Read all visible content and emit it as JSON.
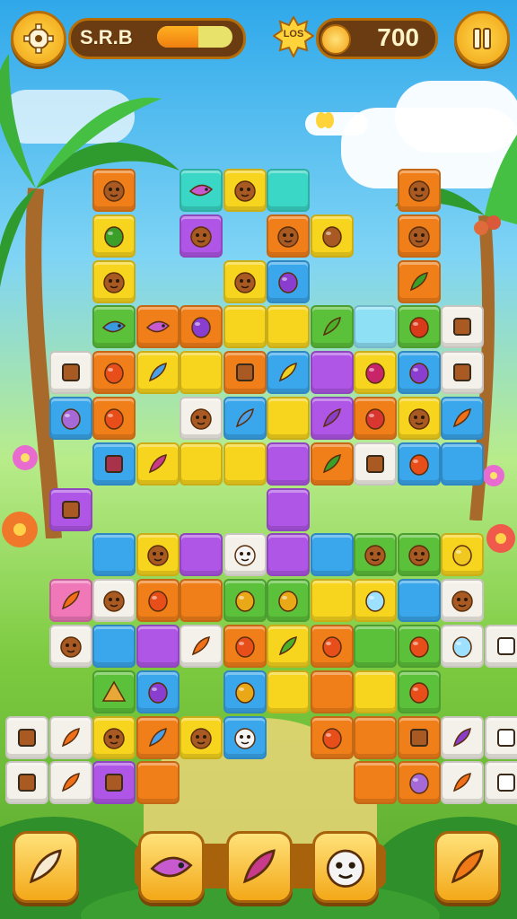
{
  "hud": {
    "level_label": "S.R.B",
    "progress": 0.55,
    "badge_text": "LOS",
    "score": "700",
    "settings_icon": "gear-icon",
    "pause_icon": "pause-icon"
  },
  "colors": {
    "orange": "#f07f1a",
    "yellow": "#f7d51e",
    "green": "#5cc13a",
    "blue": "#3aa6ec",
    "purple": "#b056e6",
    "pink": "#f077b8",
    "teal": "#3ad6c6",
    "white": "#f4f0ea",
    "red": "#e8462e",
    "lightblue": "#8ee0f4"
  },
  "tiles": [
    {
      "c": 2,
      "r": 0,
      "color": "orange",
      "icon": "fox-face-icon"
    },
    {
      "c": 4,
      "r": 0,
      "color": "teal",
      "icon": "bird-icon"
    },
    {
      "c": 5,
      "r": 0,
      "color": "yellow",
      "icon": "pig-face-icon"
    },
    {
      "c": 6,
      "r": 0,
      "color": "teal",
      "icon": ""
    },
    {
      "c": 9,
      "r": 0,
      "color": "orange",
      "icon": "monkey-face-icon"
    },
    {
      "c": 2,
      "r": 1,
      "color": "yellow",
      "icon": "bush-icon"
    },
    {
      "c": 4,
      "r": 1,
      "color": "purple",
      "icon": "crab-icon"
    },
    {
      "c": 6,
      "r": 1,
      "color": "orange",
      "icon": "squirrel-icon"
    },
    {
      "c": 7,
      "r": 1,
      "color": "yellow",
      "icon": "flower-icon"
    },
    {
      "c": 9,
      "r": 1,
      "color": "orange",
      "icon": "monkey-face-icon"
    },
    {
      "c": 2,
      "r": 2,
      "color": "yellow",
      "icon": "bear-face-icon"
    },
    {
      "c": 5,
      "r": 2,
      "color": "yellow",
      "icon": "fox-face-icon"
    },
    {
      "c": 6,
      "r": 2,
      "color": "blue",
      "icon": "plum-icon"
    },
    {
      "c": 9,
      "r": 2,
      "color": "orange",
      "icon": "leaf-icon"
    },
    {
      "c": 2,
      "r": 3,
      "color": "green",
      "icon": "fish-icon"
    },
    {
      "c": 3,
      "r": 3,
      "color": "orange",
      "icon": "bird-icon"
    },
    {
      "c": 4,
      "r": 3,
      "color": "orange",
      "icon": "plum-icon"
    },
    {
      "c": 5,
      "r": 3,
      "color": "yellow",
      "icon": ""
    },
    {
      "c": 6,
      "r": 3,
      "color": "yellow",
      "icon": ""
    },
    {
      "c": 7,
      "r": 3,
      "color": "green",
      "icon": "pea-pod-icon"
    },
    {
      "c": 8,
      "r": 3,
      "color": "lightblue",
      "icon": ""
    },
    {
      "c": 9,
      "r": 3,
      "color": "green",
      "icon": "tomato-icon"
    },
    {
      "c": 10,
      "r": 3,
      "color": "white",
      "icon": "shell-icon"
    },
    {
      "c": 1,
      "r": 4,
      "color": "white",
      "icon": "treasure-chest-icon"
    },
    {
      "c": 2,
      "r": 4,
      "color": "orange",
      "icon": "orange-icon"
    },
    {
      "c": 3,
      "r": 4,
      "color": "yellow",
      "icon": "feather-icon"
    },
    {
      "c": 4,
      "r": 4,
      "color": "yellow",
      "icon": ""
    },
    {
      "c": 5,
      "r": 4,
      "color": "orange",
      "icon": "book-icon"
    },
    {
      "c": 6,
      "r": 4,
      "color": "blue",
      "icon": "corn-icon"
    },
    {
      "c": 7,
      "r": 4,
      "color": "purple",
      "icon": ""
    },
    {
      "c": 8,
      "r": 4,
      "color": "yellow",
      "icon": "cherry-icon"
    },
    {
      "c": 9,
      "r": 4,
      "color": "blue",
      "icon": "plum-icon"
    },
    {
      "c": 10,
      "r": 4,
      "color": "white",
      "icon": "shell-icon"
    },
    {
      "c": 1,
      "r": 5,
      "color": "blue",
      "icon": "egg-icon"
    },
    {
      "c": 2,
      "r": 5,
      "color": "orange",
      "icon": "orange-icon"
    },
    {
      "c": 4,
      "r": 5,
      "color": "white",
      "icon": "deer-face-icon"
    },
    {
      "c": 5,
      "r": 5,
      "color": "blue",
      "icon": "feather-icon"
    },
    {
      "c": 6,
      "r": 5,
      "color": "yellow",
      "icon": ""
    },
    {
      "c": 7,
      "r": 5,
      "color": "purple",
      "icon": "eggplant-icon"
    },
    {
      "c": 8,
      "r": 5,
      "color": "orange",
      "icon": "strawberry-icon"
    },
    {
      "c": 9,
      "r": 5,
      "color": "yellow",
      "icon": "turtle-icon"
    },
    {
      "c": 10,
      "r": 5,
      "color": "blue",
      "icon": "carrot-icon"
    },
    {
      "c": 2,
      "r": 6,
      "color": "blue",
      "icon": "cube-icon"
    },
    {
      "c": 3,
      "r": 6,
      "color": "yellow",
      "icon": "radish-icon"
    },
    {
      "c": 4,
      "r": 6,
      "color": "yellow",
      "icon": ""
    },
    {
      "c": 5,
      "r": 6,
      "color": "yellow",
      "icon": ""
    },
    {
      "c": 6,
      "r": 6,
      "color": "purple",
      "icon": ""
    },
    {
      "c": 7,
      "r": 6,
      "color": "orange",
      "icon": "sprout-icon"
    },
    {
      "c": 8,
      "r": 6,
      "color": "white",
      "icon": "door-icon"
    },
    {
      "c": 9,
      "r": 6,
      "color": "blue",
      "icon": "orange-icon"
    },
    {
      "c": 10,
      "r": 6,
      "color": "blue",
      "icon": ""
    },
    {
      "c": 1,
      "r": 7,
      "color": "purple",
      "icon": "gate-icon"
    },
    {
      "c": 6,
      "r": 7,
      "color": "purple",
      "icon": ""
    },
    {
      "c": 2,
      "r": 8,
      "color": "blue",
      "icon": ""
    },
    {
      "c": 3,
      "r": 8,
      "color": "yellow",
      "icon": "lion-face-icon"
    },
    {
      "c": 4,
      "r": 8,
      "color": "purple",
      "icon": ""
    },
    {
      "c": 5,
      "r": 8,
      "color": "white",
      "icon": "jellyfish-icon"
    },
    {
      "c": 6,
      "r": 8,
      "color": "purple",
      "icon": ""
    },
    {
      "c": 7,
      "r": 8,
      "color": "blue",
      "icon": ""
    },
    {
      "c": 8,
      "r": 8,
      "color": "green",
      "icon": "monkey-face-icon"
    },
    {
      "c": 9,
      "r": 8,
      "color": "green",
      "icon": "monkey-face-icon"
    },
    {
      "c": 10,
      "r": 8,
      "color": "yellow",
      "icon": "lemon-icon"
    },
    {
      "c": 1,
      "r": 9,
      "color": "pink",
      "icon": "carrot-icon"
    },
    {
      "c": 2,
      "r": 9,
      "color": "white",
      "icon": "crab-icon"
    },
    {
      "c": 3,
      "r": 9,
      "color": "orange",
      "icon": "orange-icon"
    },
    {
      "c": 4,
      "r": 9,
      "color": "orange",
      "icon": ""
    },
    {
      "c": 5,
      "r": 9,
      "color": "green",
      "icon": "pear-icon"
    },
    {
      "c": 6,
      "r": 9,
      "color": "green",
      "icon": "pear-icon"
    },
    {
      "c": 7,
      "r": 9,
      "color": "yellow",
      "icon": ""
    },
    {
      "c": 8,
      "r": 9,
      "color": "yellow",
      "icon": "gem-icon"
    },
    {
      "c": 9,
      "r": 9,
      "color": "blue",
      "icon": ""
    },
    {
      "c": 10,
      "r": 9,
      "color": "white",
      "icon": "lion-face-icon"
    },
    {
      "c": 1,
      "r": 10,
      "color": "white",
      "icon": "bear-face-icon"
    },
    {
      "c": 2,
      "r": 10,
      "color": "blue",
      "icon": ""
    },
    {
      "c": 3,
      "r": 10,
      "color": "purple",
      "icon": ""
    },
    {
      "c": 4,
      "r": 10,
      "color": "white",
      "icon": "carrot-icon"
    },
    {
      "c": 5,
      "r": 10,
      "color": "orange",
      "icon": "orange-icon"
    },
    {
      "c": 6,
      "r": 10,
      "color": "yellow",
      "icon": "pea-pod-icon"
    },
    {
      "c": 7,
      "r": 10,
      "color": "orange",
      "icon": "orange-icon"
    },
    {
      "c": 8,
      "r": 10,
      "color": "green",
      "icon": ""
    },
    {
      "c": 9,
      "r": 10,
      "color": "green",
      "icon": "orange-icon"
    },
    {
      "c": 10,
      "r": 10,
      "color": "white",
      "icon": "gem-icon"
    },
    {
      "c": 11,
      "r": 10,
      "color": "white",
      "icon": "frame-icon"
    },
    {
      "c": 2,
      "r": 11,
      "color": "green",
      "icon": "pyramid-icon"
    },
    {
      "c": 3,
      "r": 11,
      "color": "blue",
      "icon": "plum-icon"
    },
    {
      "c": 5,
      "r": 11,
      "color": "blue",
      "icon": "pear-icon"
    },
    {
      "c": 6,
      "r": 11,
      "color": "yellow",
      "icon": ""
    },
    {
      "c": 7,
      "r": 11,
      "color": "orange",
      "icon": ""
    },
    {
      "c": 8,
      "r": 11,
      "color": "yellow",
      "icon": ""
    },
    {
      "c": 9,
      "r": 11,
      "color": "green",
      "icon": "orange-icon"
    },
    {
      "c": 0,
      "r": 12,
      "color": "white",
      "icon": "ice-cream-icon"
    },
    {
      "c": 1,
      "r": 12,
      "color": "white",
      "icon": "carrot-icon"
    },
    {
      "c": 2,
      "r": 12,
      "color": "yellow",
      "icon": "fox-face-icon"
    },
    {
      "c": 3,
      "r": 12,
      "color": "orange",
      "icon": "feather-icon"
    },
    {
      "c": 4,
      "r": 12,
      "color": "yellow",
      "icon": "fox-face-icon"
    },
    {
      "c": 5,
      "r": 12,
      "color": "blue",
      "icon": "rabbit-icon"
    },
    {
      "c": 7,
      "r": 12,
      "color": "orange",
      "icon": "orange-icon"
    },
    {
      "c": 8,
      "r": 12,
      "color": "orange",
      "icon": ""
    },
    {
      "c": 9,
      "r": 12,
      "color": "orange",
      "icon": "bag-icon"
    },
    {
      "c": 10,
      "r": 12,
      "color": "white",
      "icon": "eggplant-icon"
    },
    {
      "c": 11,
      "r": 12,
      "color": "white",
      "icon": "frame-icon"
    },
    {
      "c": 0,
      "r": 13,
      "color": "white",
      "icon": "drum-icon"
    },
    {
      "c": 1,
      "r": 13,
      "color": "white",
      "icon": "carrot-icon"
    },
    {
      "c": 2,
      "r": 13,
      "color": "purple",
      "icon": "bag-icon"
    },
    {
      "c": 3,
      "r": 13,
      "color": "orange",
      "icon": ""
    },
    {
      "c": 8,
      "r": 13,
      "color": "orange",
      "icon": ""
    },
    {
      "c": 9,
      "r": 13,
      "color": "orange",
      "icon": "egg-icon"
    },
    {
      "c": 10,
      "r": 13,
      "color": "white",
      "icon": "carrot-icon"
    },
    {
      "c": 11,
      "r": 13,
      "color": "white",
      "icon": "frame-icon"
    }
  ],
  "slots": [
    {
      "icon": "parsnip-icon"
    },
    {
      "icon": "bird-icon"
    },
    {
      "icon": "radish-icon"
    },
    {
      "icon": "rabbit-icon"
    },
    {
      "icon": "onion-icon"
    }
  ]
}
